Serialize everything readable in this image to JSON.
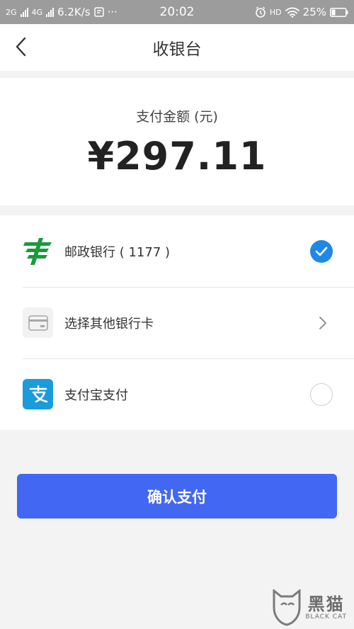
{
  "status_bar": {
    "net1": "2G",
    "net2": "4G",
    "speed": "6.2K/s",
    "dots": "···",
    "time": "20:02",
    "hd": "HD",
    "battery": "25%"
  },
  "nav": {
    "title": "收银台"
  },
  "amount": {
    "label": "支付金额 (元)",
    "value": "¥297.11"
  },
  "methods": [
    {
      "label": "邮政银行 ( 1177 )",
      "icon": "postal-bank-logo-icon",
      "state": "selected"
    },
    {
      "label": "选择其他银行卡",
      "icon": "bank-card-icon",
      "state": "chevron"
    },
    {
      "label": "支付宝支付",
      "icon": "alipay-icon",
      "state": "unselected"
    }
  ],
  "confirm_label": "确认支付",
  "watermark": {
    "cn": "黑猫",
    "en": "BLACK CAT"
  },
  "colors": {
    "accent": "#4267f2",
    "check": "#1e88e5",
    "status_bar": "#9c9c9c",
    "postal_green": "#1a9a3c",
    "alipay_blue": "#1a9bdc"
  }
}
